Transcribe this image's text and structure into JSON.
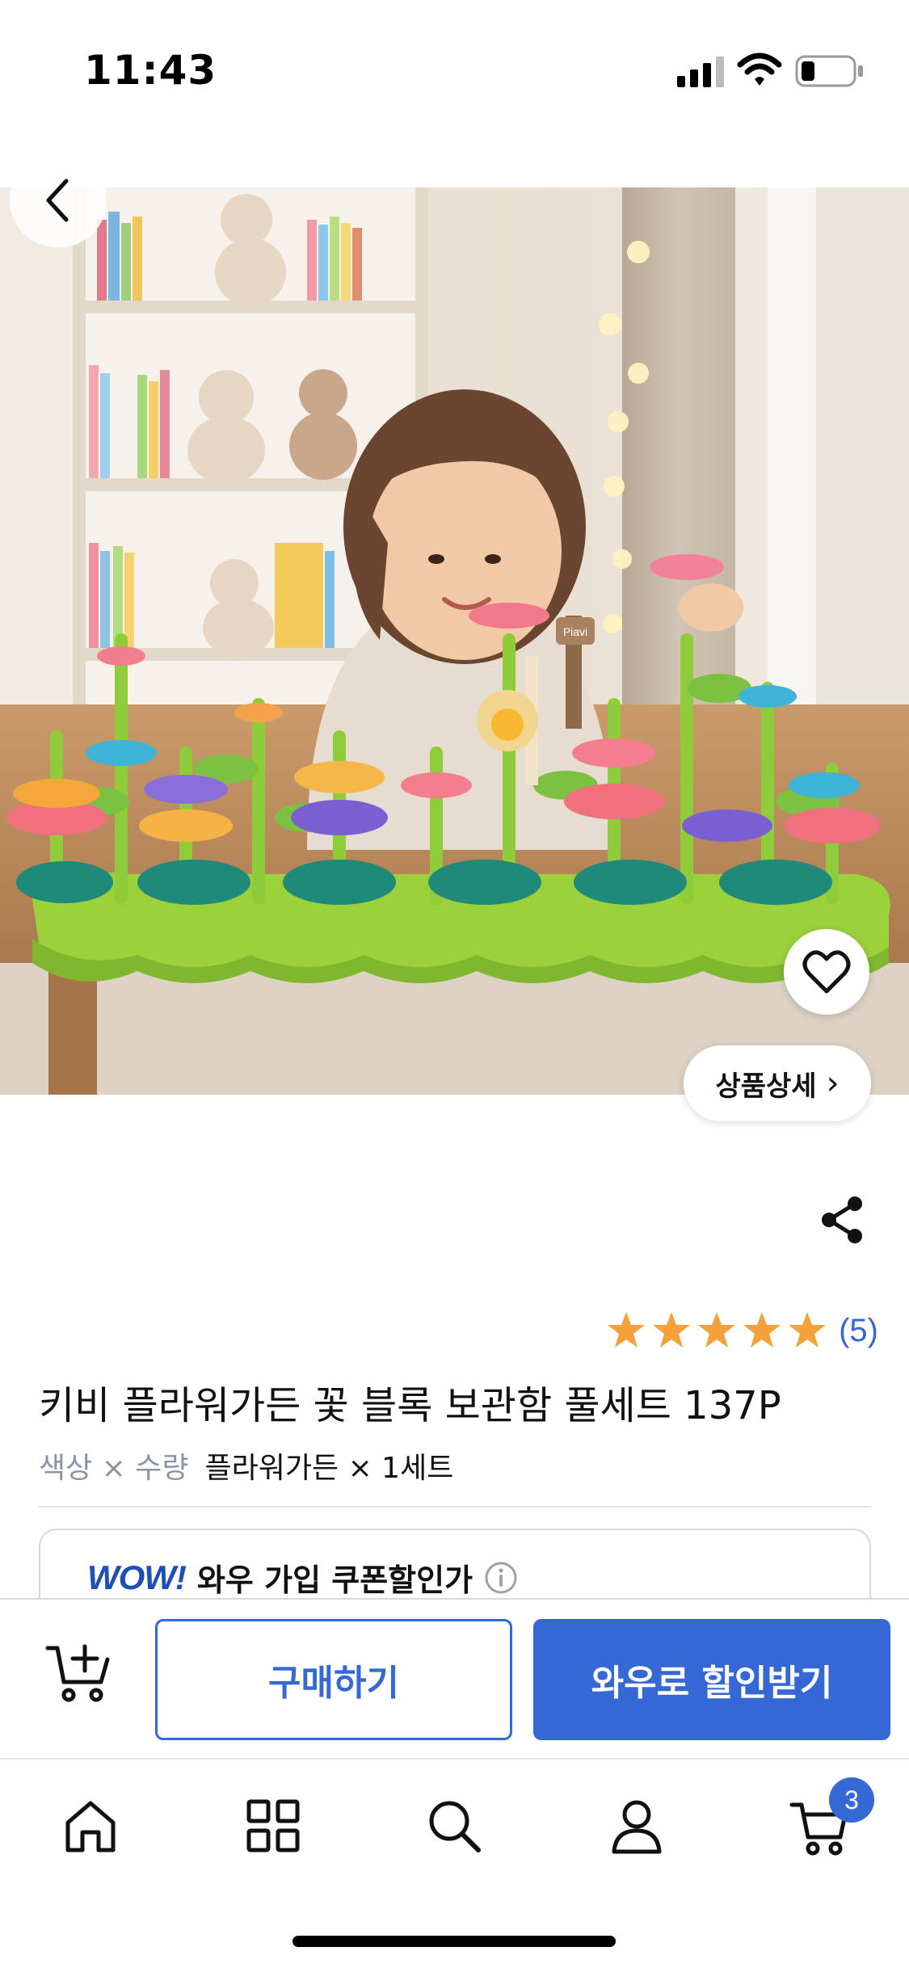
{
  "status_bar": {
    "time": "11:43"
  },
  "hero": {
    "sign_text": "Piavi",
    "detail_label": "상품상세",
    "detail_chevron": "›"
  },
  "product": {
    "rating_stars": 5,
    "review_count": "(5)",
    "title": "키비 플라워가든 꽃 블록 보관함 풀세트 137P",
    "option_label": "색상 × 수량",
    "option_value": "플라워가든 × 1세트"
  },
  "wow": {
    "logo": "WOW!",
    "text": "와우 가입 쿠폰할인가"
  },
  "actions": {
    "buy_label": "구매하기",
    "wow_buy_label": "와우로 할인받기"
  },
  "tab_bar": {
    "items": [
      "home-icon",
      "category-icon",
      "search-icon",
      "profile-icon",
      "cart-icon"
    ],
    "cart_count": "3"
  },
  "colors": {
    "accent": "#3568d4",
    "star": "#f5a03a",
    "text_gray": "#8a94a3"
  }
}
